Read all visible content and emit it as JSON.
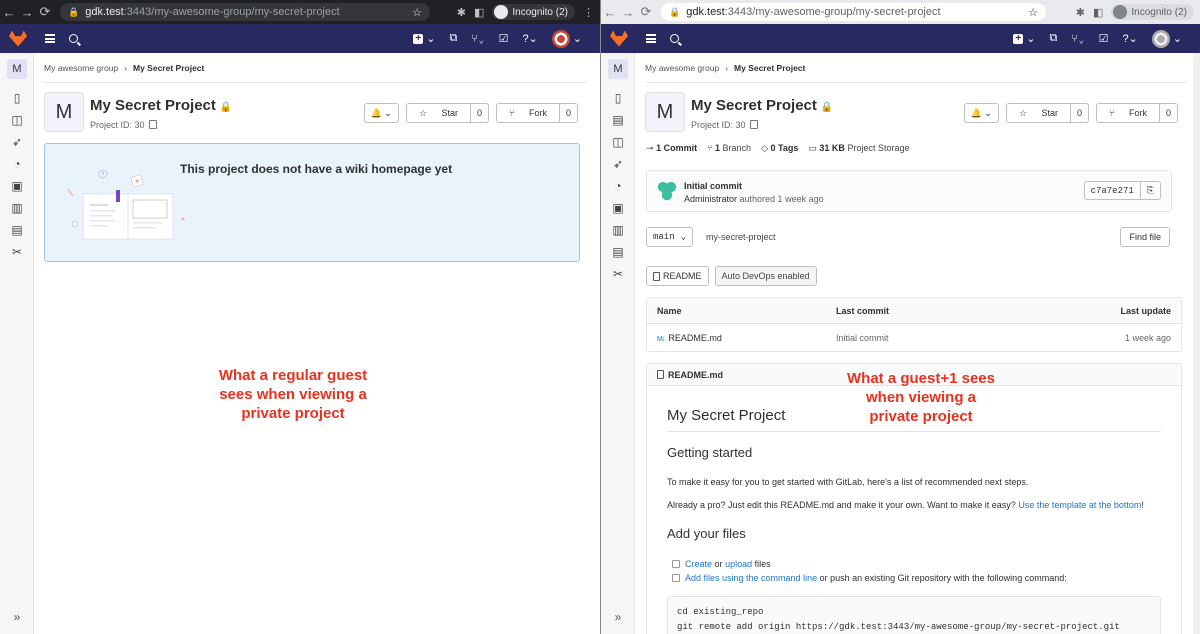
{
  "left": {
    "url_host": "gdk.test",
    "url_path": ":3443/my-awesome-group/my-secret-project",
    "incognito_label": "Incognito (2)",
    "sidebar_avatar": "M",
    "breadcrumb": [
      "My awesome group",
      "My Secret Project"
    ],
    "project_avatar": "M",
    "project_title": "My Secret Project",
    "project_id": "Project ID: 30",
    "star_label": "Star",
    "star_count": "0",
    "fork_label": "Fork",
    "fork_count": "0",
    "wiki_empty_title": "This project does not have a wiki homepage yet",
    "annotation": "What a regular guest sees when viewing a private project"
  },
  "right": {
    "url_host": "gdk.test",
    "url_path": ":3443/my-awesome-group/my-secret-project",
    "incognito_label": "Incognito (2)",
    "sidebar_avatar": "M",
    "breadcrumb": [
      "My awesome group",
      "My Secret Project"
    ],
    "project_avatar": "M",
    "project_title": "My Secret Project",
    "project_id": "Project ID: 30",
    "star_label": "Star",
    "star_count": "0",
    "fork_label": "Fork",
    "fork_count": "0",
    "stats": {
      "commits_num": "1",
      "commits_label": "Commit",
      "branches_num": "1",
      "branches_label": "Branch",
      "tags_num": "0",
      "tags_label": "Tags",
      "storage_num": "31 KB",
      "storage_label": "Project Storage"
    },
    "commit": {
      "title": "Initial commit",
      "author": "Administrator",
      "authored": "authored 1 week ago",
      "sha": "c7a7e271"
    },
    "branch": "main",
    "repo_name": "my-secret-project",
    "find_file": "Find file",
    "readme_btn": "README",
    "autodevops_btn": "Auto DevOps enabled",
    "table": {
      "headers": [
        "Name",
        "Last commit",
        "Last update"
      ],
      "rows": [
        {
          "name": "README.md",
          "last_commit": "Initial commit",
          "last_update": "1 week ago"
        }
      ]
    },
    "readme": {
      "file": "README.md",
      "h1": "My Secret Project",
      "getting_started": "Getting started",
      "p1": "To make it easy for you to get started with GitLab, here's a list of recommended next steps.",
      "p2_text": "Already a pro? Just edit this README.md and make it your own. Want to make it easy?",
      "p2_link": "Use the template at the bottom",
      "p2_end": "!",
      "add_files": "Add your files",
      "chk1_link1": "Create",
      "chk1_or": "or",
      "chk1_link2": "upload",
      "chk1_end": "files",
      "chk2_link": "Add files using the command line",
      "chk2_end": "or push an existing Git repository with the following command:",
      "code_line1": "cd existing_repo",
      "code_line2": "git remote add origin https://gdk.test:3443/my-awesome-group/my-secret-project.git"
    },
    "annotation": "What a guest+1 sees when viewing a private project"
  },
  "colors": {
    "header_bg": "#292961",
    "annotation": "#e8321f",
    "wiki_box_bg": "#e9f3fc",
    "link": "#1f75cb"
  }
}
